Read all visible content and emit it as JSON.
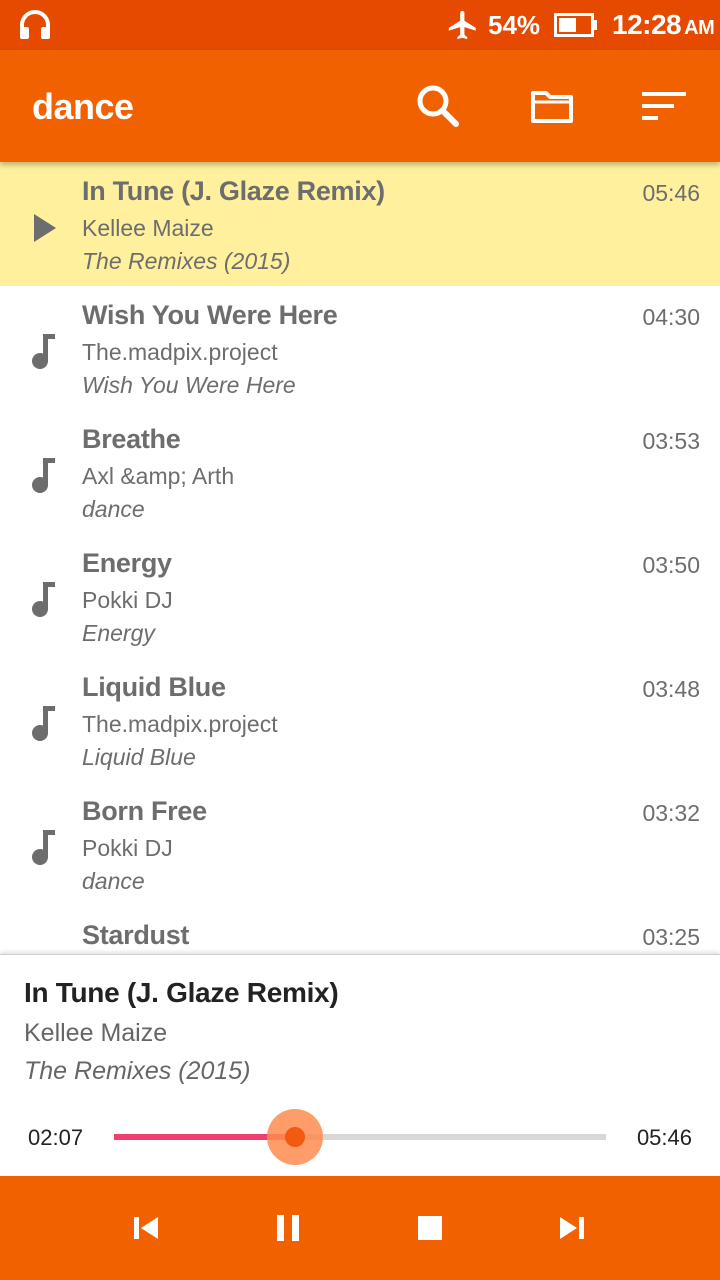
{
  "status_bar": {
    "battery_percent": "54%",
    "time": "12:28",
    "ampm": "AM",
    "icons": [
      "headphones-icon",
      "airplane-mode-icon",
      "battery-icon"
    ]
  },
  "app_bar": {
    "title": "dance",
    "actions": [
      "search-icon",
      "folder-icon",
      "sort-icon"
    ]
  },
  "colors": {
    "status_bar": "#e54a00",
    "app_bar": "#f26100",
    "active_row": "#fff09e",
    "seek_fill": "#ef3f6e",
    "seek_thumb": "#f25a10"
  },
  "tracks": [
    {
      "title": "In Tune (J. Glaze Remix)",
      "artist": "Kellee Maize",
      "album": "The Remixes (2015)",
      "duration": "05:46",
      "icon": "play-icon",
      "active": true
    },
    {
      "title": "Wish You Were Here",
      "artist": "The.madpix.project",
      "album": "Wish You Were Here",
      "duration": "04:30",
      "icon": "music-note-icon"
    },
    {
      "title": "Breathe",
      "artist": "Axl &amp; Arth",
      "album": "dance",
      "duration": "03:53",
      "icon": "music-note-icon"
    },
    {
      "title": "Energy",
      "artist": "Pokki DJ",
      "album": "Energy",
      "duration": "03:50",
      "icon": "music-note-icon"
    },
    {
      "title": "Liquid Blue",
      "artist": "The.madpix.project",
      "album": "Liquid Blue",
      "duration": "03:48",
      "icon": "music-note-icon"
    },
    {
      "title": "Born Free",
      "artist": "Pokki DJ",
      "album": "dance",
      "duration": "03:32",
      "icon": "music-note-icon"
    },
    {
      "title": "Stardust",
      "artist": "",
      "album": "",
      "duration": "03:25",
      "icon": "music-note-icon"
    }
  ],
  "now_playing": {
    "title": "In Tune (J. Glaze Remix)",
    "artist": "Kellee Maize",
    "album": "The Remixes (2015)",
    "elapsed": "02:07",
    "total": "05:46",
    "progress": 0.367
  },
  "controls": [
    "skip-previous-icon",
    "pause-icon",
    "stop-icon",
    "skip-next-icon"
  ]
}
